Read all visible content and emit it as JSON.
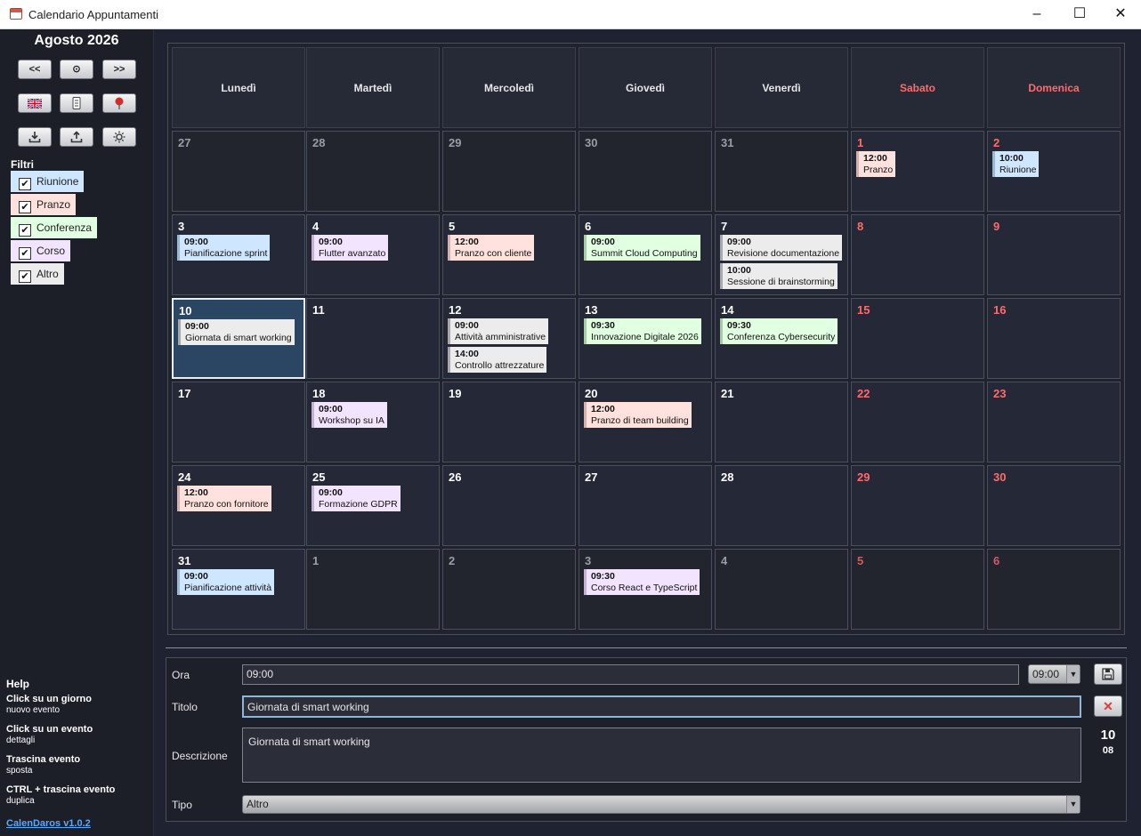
{
  "window": {
    "title": "Calendario Appuntamenti",
    "minimize": "–",
    "maximize": "☐",
    "close": "✕"
  },
  "sidebar": {
    "month_title": "Agosto 2026",
    "nav": {
      "prev": "<<",
      "today": "⊙",
      "next": ">>"
    },
    "filters_title": "Filtri",
    "filters": [
      {
        "label": "Riunione",
        "checked": true,
        "color": "#cfe6ff"
      },
      {
        "label": "Pranzo",
        "checked": true,
        "color": "#ffe1dd"
      },
      {
        "label": "Conferenza",
        "checked": true,
        "color": "#e1ffe1"
      },
      {
        "label": "Corso",
        "checked": true,
        "color": "#f2e3ff"
      },
      {
        "label": "Altro",
        "checked": true,
        "color": "#ececec"
      }
    ],
    "help": {
      "title": "Help",
      "items": [
        {
          "title": "Click su un giorno",
          "desc": "nuovo evento"
        },
        {
          "title": "Click su un evento",
          "desc": "dettagli"
        },
        {
          "title": "Trascina evento",
          "desc": "sposta"
        },
        {
          "title": "CTRL + trascina evento",
          "desc": "duplica"
        }
      ]
    },
    "version": "CalenDaros v1.0.2"
  },
  "calendar": {
    "weekdays": [
      "Lunedì",
      "Martedì",
      "Mercoledì",
      "Giovedì",
      "Venerdì",
      "Sabato",
      "Domenica"
    ],
    "weeks": [
      [
        {
          "day": "27",
          "other": true,
          "events": []
        },
        {
          "day": "28",
          "other": true,
          "events": []
        },
        {
          "day": "29",
          "other": true,
          "events": []
        },
        {
          "day": "30",
          "other": true,
          "events": []
        },
        {
          "day": "31",
          "other": true,
          "events": []
        },
        {
          "day": "1",
          "events": [
            {
              "time": "12:00",
              "title": "Pranzo",
              "type": "Pranzo"
            }
          ]
        },
        {
          "day": "2",
          "events": [
            {
              "time": "10:00",
              "title": "Riunione",
              "type": "Riunione"
            }
          ]
        }
      ],
      [
        {
          "day": "3",
          "events": [
            {
              "time": "09:00",
              "title": "Pianificazione sprint",
              "type": "Riunione"
            }
          ]
        },
        {
          "day": "4",
          "events": [
            {
              "time": "09:00",
              "title": "Flutter avanzato",
              "type": "Corso"
            }
          ]
        },
        {
          "day": "5",
          "events": [
            {
              "time": "12:00",
              "title": "Pranzo con cliente",
              "type": "Pranzo"
            }
          ]
        },
        {
          "day": "6",
          "events": [
            {
              "time": "09:00",
              "title": "Summit Cloud Computing",
              "type": "Conferenza"
            }
          ]
        },
        {
          "day": "7",
          "events": [
            {
              "time": "09:00",
              "title": "Revisione documentazione",
              "type": "Altro"
            },
            {
              "time": "10:00",
              "title": "Sessione di brainstorming",
              "type": "Altro"
            }
          ]
        },
        {
          "day": "8",
          "events": []
        },
        {
          "day": "9",
          "events": []
        }
      ],
      [
        {
          "day": "10",
          "selected": true,
          "events": [
            {
              "time": "09:00",
              "title": "Giornata di smart working",
              "type": "Altro"
            }
          ]
        },
        {
          "day": "11",
          "events": []
        },
        {
          "day": "12",
          "events": [
            {
              "time": "09:00",
              "title": "Attività amministrative",
              "type": "Altro"
            },
            {
              "time": "14:00",
              "title": "Controllo attrezzature",
              "type": "Altro"
            }
          ]
        },
        {
          "day": "13",
          "events": [
            {
              "time": "09:30",
              "title": "Innovazione Digitale 2026",
              "type": "Conferenza"
            }
          ]
        },
        {
          "day": "14",
          "events": [
            {
              "time": "09:30",
              "title": "Conferenza Cybersecurity",
              "type": "Conferenza"
            }
          ]
        },
        {
          "day": "15",
          "events": []
        },
        {
          "day": "16",
          "events": []
        }
      ],
      [
        {
          "day": "17",
          "events": []
        },
        {
          "day": "18",
          "events": [
            {
              "time": "09:00",
              "title": "Workshop su IA",
              "type": "Corso"
            }
          ]
        },
        {
          "day": "19",
          "events": []
        },
        {
          "day": "20",
          "events": [
            {
              "time": "12:00",
              "title": "Pranzo di team building",
              "type": "Pranzo"
            }
          ]
        },
        {
          "day": "21",
          "events": []
        },
        {
          "day": "22",
          "events": []
        },
        {
          "day": "23",
          "events": []
        }
      ],
      [
        {
          "day": "24",
          "events": [
            {
              "time": "12:00",
              "title": "Pranzo con fornitore",
              "type": "Pranzo"
            }
          ]
        },
        {
          "day": "25",
          "events": [
            {
              "time": "09:00",
              "title": "Formazione GDPR",
              "type": "Corso"
            }
          ]
        },
        {
          "day": "26",
          "events": []
        },
        {
          "day": "27",
          "events": []
        },
        {
          "day": "28",
          "events": []
        },
        {
          "day": "29",
          "events": []
        },
        {
          "day": "30",
          "events": []
        }
      ],
      [
        {
          "day": "31",
          "events": [
            {
              "time": "09:00",
              "title": "Pianificazione attività",
              "type": "Riunione"
            }
          ]
        },
        {
          "day": "1",
          "other": true,
          "events": []
        },
        {
          "day": "2",
          "other": true,
          "events": []
        },
        {
          "day": "3",
          "other": true,
          "events": [
            {
              "time": "09:30",
              "title": "Corso React e TypeScript",
              "type": "Corso"
            }
          ]
        },
        {
          "day": "4",
          "other": true,
          "events": []
        },
        {
          "day": "5",
          "other": true,
          "events": []
        },
        {
          "day": "6",
          "other": true,
          "events": []
        }
      ]
    ]
  },
  "form": {
    "ora_label": "Ora",
    "ora_value": "09:00",
    "ora_combo": "09:00",
    "titolo_label": "Titolo",
    "titolo_value": "Giornata di smart working",
    "descrizione_label": "Descrizione",
    "descrizione_value": "Giornata di smart working",
    "tipo_label": "Tipo",
    "tipo_value": "Altro",
    "selected_day": "10",
    "selected_month": "08"
  }
}
